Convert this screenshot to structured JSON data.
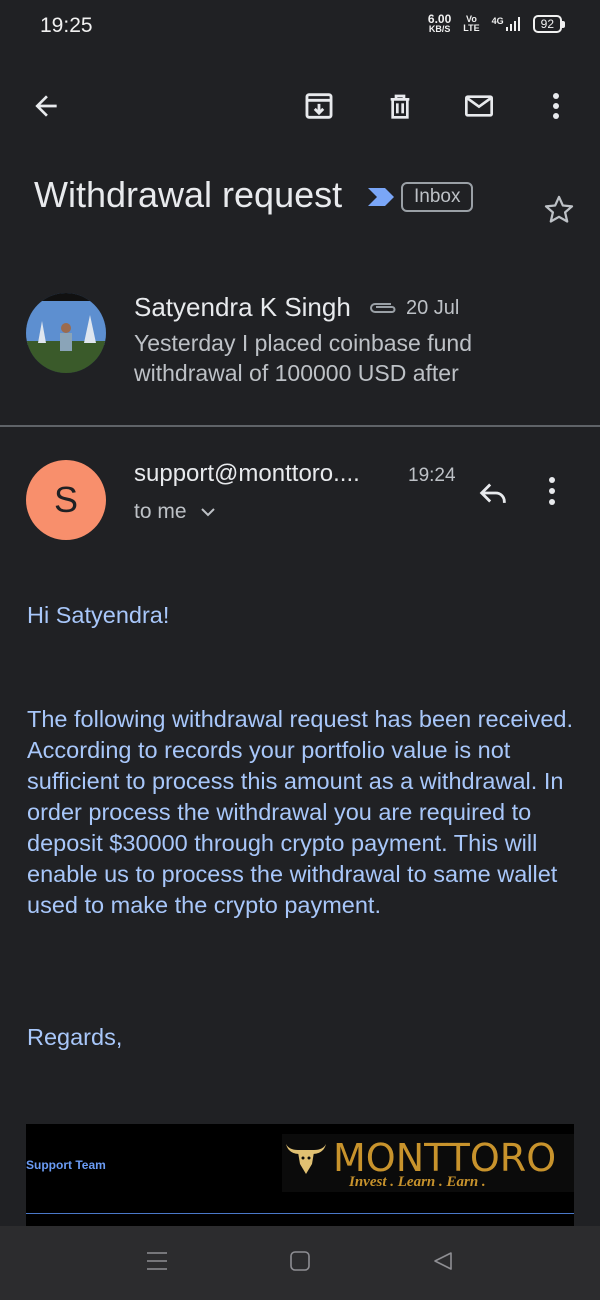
{
  "status_bar": {
    "time": "19:25",
    "net_speed": "6.00",
    "net_unit": "KB/S",
    "volte_top": "Vo",
    "volte_bottom": "LTE",
    "network": "4G",
    "battery": "92"
  },
  "toolbar": {
    "back_icon": "arrow-left-icon",
    "archive_icon": "archive-icon",
    "delete_icon": "trash-icon",
    "mark_unread_icon": "mail-icon",
    "more_icon": "more-vertical-icon"
  },
  "email": {
    "subject": "Withdrawal request",
    "label": "Inbox",
    "star_icon": "star-outline-icon"
  },
  "thread": [
    {
      "sender": "Satyendra K Singh",
      "date": "20 Jul",
      "snippet": "Yesterday I placed coinbase fund withdrawal of 100000 USD after",
      "has_attachment": true
    },
    {
      "sender": "support@monttoro....",
      "time": "19:24",
      "avatar_letter": "S",
      "avatar_color": "#f88f6c",
      "recipient_line": "to me",
      "body": {
        "greeting": "Hi Satyendra!",
        "paragraph": "The following withdrawal request has been received. According to records your portfolio value is not sufficient to process this amount as a withdrawal. In  order process the withdrawal you are required to deposit $30000 through crypto payment. This will enable us to process the withdrawal to same wallet used to make the crypto payment.",
        "closing": "Regards,"
      },
      "signature": {
        "team": "Support Team",
        "brand": "MONTTORO",
        "tagline": "Invest . Learn . Earn ."
      }
    }
  ],
  "colors": {
    "background": "#202124",
    "link_text": "#a8c7fa",
    "brand_gold": "#c8932c"
  },
  "nav_bar": {
    "menu_icon": "menu-icon",
    "home_icon": "home-square-icon",
    "back_icon": "back-triangle-icon"
  }
}
